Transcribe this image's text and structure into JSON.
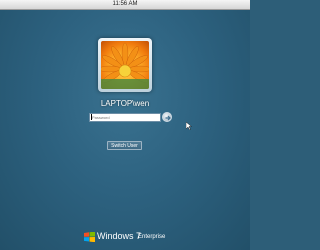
{
  "status_bar": {
    "time": "11:56 AM"
  },
  "user": {
    "name": "LAPTOP\\wen",
    "tile_icon": "orange-flower-icon"
  },
  "login": {
    "password_placeholder": "Password",
    "submit_icon": "arrow-right-icon",
    "switch_user_label": "Switch User"
  },
  "branding": {
    "product": "Windows 7",
    "edition": "Enterprise",
    "logo_icon": "windows-flag-icon"
  },
  "colors": {
    "background": "#2d5e78",
    "flower_orange": "#f07a0d"
  }
}
